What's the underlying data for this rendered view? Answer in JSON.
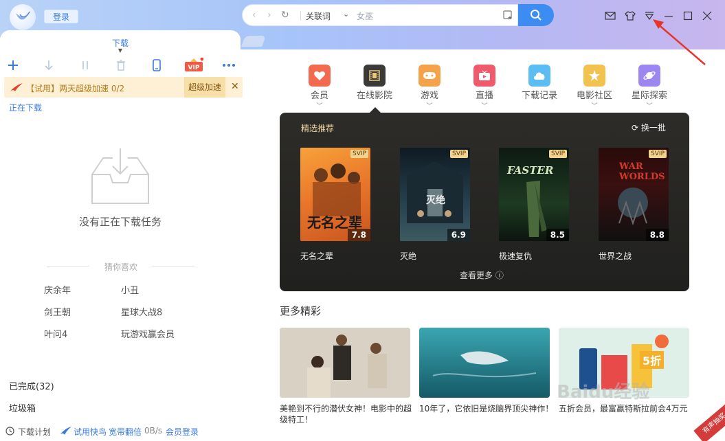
{
  "header": {
    "login_label": "登录",
    "address": {
      "keyword_label": "关联词",
      "query_placeholder": "女巫"
    }
  },
  "left_panel": {
    "title": "下载",
    "promo": {
      "text": "【试用】两天超级加速 0/2",
      "button": "超级加速"
    },
    "downloading_label": "正在下载",
    "empty_text": "没有正在下载任务",
    "guess_label": "猜你喜欢",
    "recommendations": [
      "庆余年",
      "小丑",
      "剑王朝",
      "星球大战8",
      "叶问4",
      "玩游戏赢会员"
    ],
    "completed_label": "已完成(32)",
    "trash_label": "垃圾箱",
    "status": {
      "plan": "下载计划",
      "trial": "试用快鸟",
      "broadband": "宽带翻倍",
      "speed": "0B/s",
      "member_login": "会员登录"
    }
  },
  "categories": [
    {
      "label": "会员",
      "icon": "heart-icon",
      "color": "#f26b4f",
      "has_chevron": true
    },
    {
      "label": "在线影院",
      "icon": "film-icon",
      "color": "#3a3a38",
      "has_chevron": false
    },
    {
      "label": "游戏",
      "icon": "gamepad-icon",
      "color": "#f5a34a",
      "has_chevron": true
    },
    {
      "label": "直播",
      "icon": "tv-icon",
      "color": "#f05a6a",
      "has_chevron": true
    },
    {
      "label": "下载记录",
      "icon": "cloud-icon",
      "color": "#5bbdf2",
      "has_chevron": false
    },
    {
      "label": "电影社区",
      "icon": "star-icon",
      "color": "#f2c24f",
      "has_chevron": true
    },
    {
      "label": "星际探索",
      "icon": "planet-icon",
      "color": "#9b86f2",
      "has_chevron": true
    }
  ],
  "featured": {
    "title": "精选推荐",
    "refresh_label": "换一批",
    "more_label": "查看更多",
    "movies": [
      {
        "title": "无名之辈",
        "score": "7.8",
        "badge": "SVIP",
        "poster_text": "无名之辈"
      },
      {
        "title": "灭绝",
        "score": "6.9",
        "badge": "SVIP",
        "poster_text": "灭绝"
      },
      {
        "title": "极速复仇",
        "score": "8.5",
        "badge": "SVIP",
        "poster_text": "FASTER"
      },
      {
        "title": "世界之战",
        "score": "8.8",
        "badge": "SVIP",
        "poster_text": "WAR WORLDS"
      }
    ]
  },
  "more_section": {
    "title": "更多精彩",
    "cards": [
      {
        "caption": "美艳到不行的潜伏女神！电影中的超级特工！"
      },
      {
        "caption": "10年了，它依旧是烧脑界顶尖神作！"
      },
      {
        "caption": "五折会员，最富赢特斯拉前会4万元",
        "badge": "5折"
      }
    ]
  },
  "overlays": {
    "watermark": "Baidu经验",
    "stamp": "有声抽奖"
  }
}
